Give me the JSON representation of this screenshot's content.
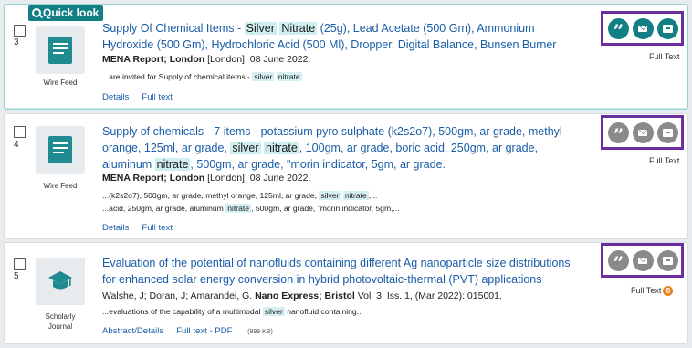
{
  "quick_look_label": "Quick look",
  "results": [
    {
      "number": "3",
      "type_label": "Wire Feed",
      "title_parts": [
        "Supply Of Chemical Items - ",
        "Silver",
        " ",
        "Nitrate",
        " (25g), Lead Acetate (500 Gm), Ammonium Hydroxide (500 Gm), Hydrochloric Acid (500 Ml), Dropper, Digital Balance, Bunsen Burner"
      ],
      "source_bold": "MENA Report; London",
      "source_rest": " [London]. 08 June 2022.",
      "snippet1_pre": "...are invited for Supply of chemical items - ",
      "snippet1_hl1": "silver",
      "snippet1_mid": " ",
      "snippet1_hl2": "nitrate",
      "snippet1_post": "...",
      "link1": "Details",
      "link2": "Full text",
      "fulltext_label": "Full Text"
    },
    {
      "number": "4",
      "type_label": "Wire Feed",
      "title_a": "Supply of chemicals - 7 items - potassium pyro sulphate (k2s2o7), 500gm, ar grade, methyl orange, 125ml, ar grade, ",
      "title_hl1": "silver",
      "title_b": " ",
      "title_hl2": "nitrate",
      "title_c": ", 100gm, ar grade, boric acid, 250gm, ar grade, aluminum ",
      "title_hl3": "nitrate",
      "title_d": ", 500gm, ar grade, \"morin indicator, 5gm, ar grade.",
      "source_bold": "MENA Report; London",
      "source_rest": " [London]. 08 June 2022.",
      "snippet1_pre": "...(k2s2o7), 500gm, ar grade, methyl orange, 125ml, ar grade, ",
      "snippet1_hl1": "silver",
      "snippet1_hl2": "nitrate",
      "snippet1_post": ",...",
      "snippet2_pre": "...acid, 250gm, ar grade, aluminum ",
      "snippet2_hl": "nitrate",
      "snippet2_post": ", 500gm, ar grade, \"morin indicator, 5gm,...",
      "link1": "Details",
      "link2": "Full text",
      "fulltext_label": "Full Text"
    },
    {
      "number": "5",
      "type_label_1": "Scholarly",
      "type_label_2": "Journal",
      "title": "Evaluation of the potential of nanofluids containing different Ag nanoparticle size distributions for enhanced solar energy conversion in hybrid photovoltaic-thermal (PVT) applications",
      "authors": "Walshe, J; Doran, J; Amarandei, G. ",
      "journal_bold": "Nano Express; Bristol",
      "journal_rest": " Vol. 3, Iss. 1,  (Mar 2022): 015001.",
      "snippet_pre": "...evaluations of the capability of a multimodal ",
      "snippet_hl": "silver",
      "snippet_post": " nanofluid containing...",
      "link1": "Abstract/Details",
      "link2": "Full text - PDF",
      "link2_size": "(899 KB)",
      "fulltext_label": "Full Text",
      "fulltext_badge": "8"
    }
  ],
  "colors": {
    "accent": "#137e83",
    "link": "#1a5da8",
    "highlight": "#cfeef0",
    "action_border": "#6a2ea0",
    "badge": "#e9831e"
  },
  "icons": [
    "search-icon",
    "document-icon",
    "graduation-cap-icon",
    "quote-icon",
    "email-icon",
    "save-icon"
  ]
}
